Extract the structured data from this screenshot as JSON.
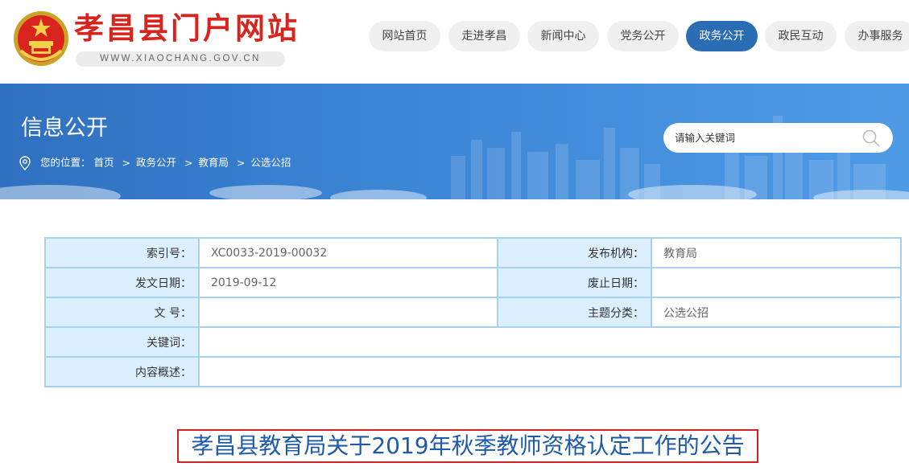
{
  "site": {
    "title": "孝昌县门户网站",
    "url": "WWW.XIAOCHANG.GOV.CN"
  },
  "nav": {
    "items": [
      {
        "label": "网站首页"
      },
      {
        "label": "走进孝昌"
      },
      {
        "label": "新闻中心"
      },
      {
        "label": "党务公开"
      },
      {
        "label": "政务公开",
        "active": true
      },
      {
        "label": "政民互动"
      },
      {
        "label": "办事服务"
      }
    ],
    "active_color": "#2a6db5"
  },
  "banner": {
    "title": "信息公开",
    "breadcrumb": {
      "prefix": "您的位置：",
      "items": [
        "首页",
        "政务公开",
        "教育局",
        "公选公招"
      ],
      "separator": ">"
    }
  },
  "search": {
    "placeholder": "请输入关键词",
    "icon": "search-icon"
  },
  "meta": {
    "index_label": "索引号：",
    "index_value": "XC0033-2019-00032",
    "publisher_label": "发布机构：",
    "publisher_value": "教育局",
    "issue_date_label": "发文日期：",
    "issue_date_value": "2019-09-12",
    "expiry_date_label": "废止日期：",
    "expiry_date_value": "",
    "doc_no_label": "文 号：",
    "doc_no_value": "",
    "category_label": "主题分类：",
    "category_value": "公选公招",
    "keywords_label": "关键词：",
    "keywords_value": "",
    "summary_label": "内容概述：",
    "summary_value": ""
  },
  "article": {
    "title": "孝昌县教育局关于2019年秋季教师资格认定工作的公告"
  },
  "colors": {
    "brand_red": "#d8241c",
    "banner_blue": "#3d86d6",
    "table_border": "#a6d1f0",
    "label_bg": "#dcefff"
  }
}
